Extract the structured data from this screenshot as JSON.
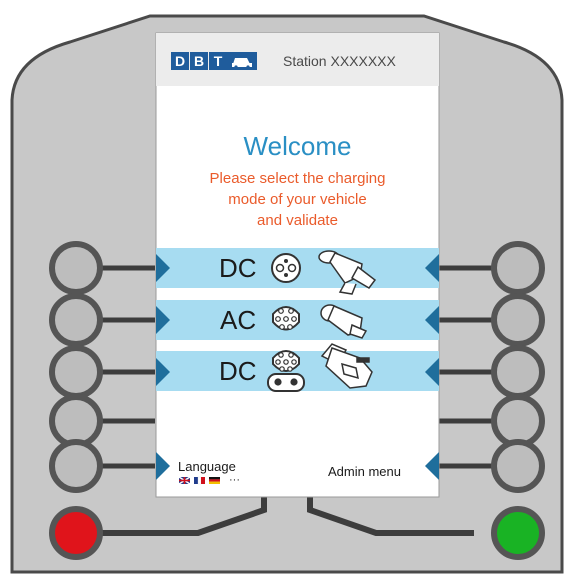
{
  "brand": {
    "letters": [
      "D",
      "B",
      "T"
    ],
    "station_label": "Station XXXXXXX"
  },
  "screen": {
    "welcome_title": "Welcome",
    "instruction_line1": "Please select the charging",
    "instruction_line2": "mode of your vehicle",
    "instruction_line3": "and validate"
  },
  "modes": [
    {
      "label": "DC",
      "socket_icon": "chademo-socket-icon",
      "plug_icon": "chademo-plug-icon"
    },
    {
      "label": "AC",
      "socket_icon": "type2-socket-icon",
      "plug_icon": "type2-plug-icon"
    },
    {
      "label": "DC",
      "socket_icon": "ccs-combo-socket-icon",
      "plug_icon": "ccs-combo-plug-icon"
    }
  ],
  "footer": {
    "language_label": "Language",
    "language_more": "···",
    "flags": [
      "uk-flag-icon",
      "france-flag-icon",
      "germany-flag-icon"
    ],
    "admin_label": "Admin menu"
  },
  "colors": {
    "housing": "#c8c8c8",
    "housing_outline": "#4a4a4a",
    "screen_header": "#ececec",
    "band": "#a7dcf1",
    "arrow": "#1f6e9c",
    "brand": "#1f5c9c",
    "title": "#2a8fc4",
    "instruction": "#ea5b2b",
    "cancel_button": "#e0141b",
    "validate_button": "#19b324"
  }
}
